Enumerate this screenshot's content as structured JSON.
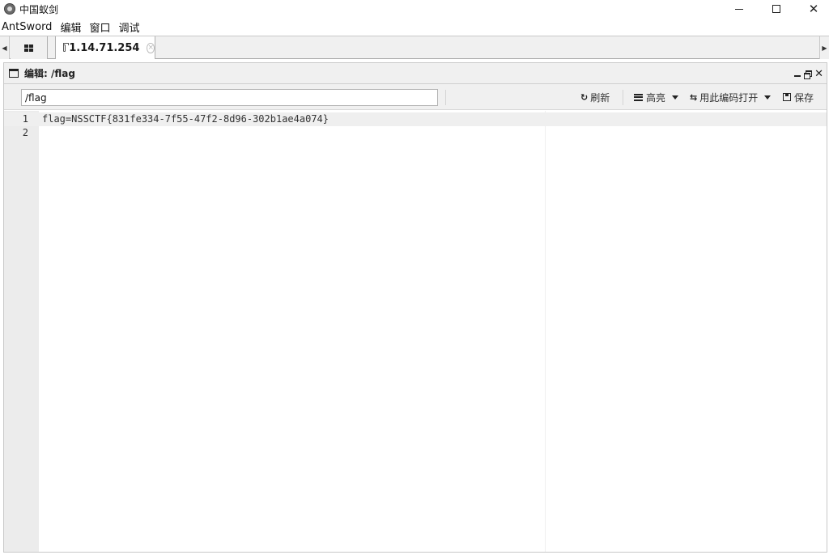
{
  "window": {
    "title": "中国蚁剑",
    "minimize_glyph": "—",
    "close_glyph": "✕"
  },
  "menu": [
    "AntSword",
    "编辑",
    "窗口",
    "调试"
  ],
  "tabs": {
    "active_label": "1.14.71.254",
    "close_glyph": "×"
  },
  "panel": {
    "title": "编辑: /flag",
    "close_glyph": "✕"
  },
  "toolbar": {
    "path_value": "/flag",
    "refresh_icon": "↻",
    "refresh_label": "刷新",
    "highlight_label": "高亮",
    "open_encoding_icon": "⇆",
    "open_encoding_label": "用此编码打开",
    "save_label": "保存"
  },
  "editor": {
    "lines": [
      {
        "num": "1",
        "text": "flag=NSSCTF{831fe334-7f55-47f2-8d96-302b1ae4a074}"
      },
      {
        "num": "2",
        "text": ""
      }
    ]
  },
  "icons": {
    "app": "antsword-logo-icon",
    "home_tab": "grid-icon",
    "tab": "folder-icon",
    "panel": "window-icon",
    "refresh": "refresh-icon",
    "highlight": "list-icon",
    "open_encoding": "file-encoding-icon",
    "save": "save-icon"
  }
}
